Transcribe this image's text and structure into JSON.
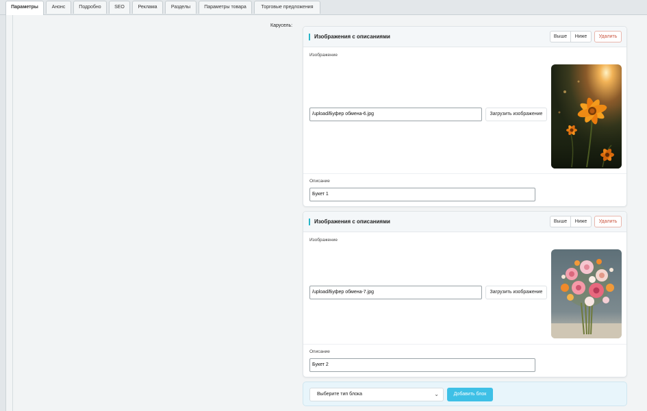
{
  "tabs": [
    {
      "label": "Параметры"
    },
    {
      "label": "Анонс"
    },
    {
      "label": "Подробно"
    },
    {
      "label": "SEO"
    },
    {
      "label": "Реклама"
    },
    {
      "label": "Разделы"
    },
    {
      "label": "Параметры товара"
    },
    {
      "label": "Торговые предложения"
    }
  ],
  "field_label": "Карусель:",
  "cards": [
    {
      "title": "Изображения с описаниями",
      "btn_up": "Выше",
      "btn_down": "Ниже",
      "btn_delete": "Удалить",
      "image_label": "Изображение",
      "image_path": "/upload/Буфер обмена-6.jpg",
      "upload_label": "Загрузить изображение",
      "desc_label": "Описание",
      "desc_value": "Букет 1",
      "thumb_icon": "orange-flower-photo"
    },
    {
      "title": "Изображения с описаниями",
      "btn_up": "Выше",
      "btn_down": "Ниже",
      "btn_delete": "Удалить",
      "image_label": "Изображение",
      "image_path": "/upload/Буфер обмена-7.jpg",
      "upload_label": "Загрузить изображение",
      "desc_label": "Описание",
      "desc_value": "Букет 2",
      "thumb_icon": "flower-bouquet-photo"
    }
  ],
  "add_block": {
    "select_value": "Выберите тип блока",
    "button_label": "Добавить блок"
  },
  "colors": {
    "accent": "#29b6c8",
    "add_button": "#3ec0e6",
    "delete_text": "#c9533d"
  }
}
